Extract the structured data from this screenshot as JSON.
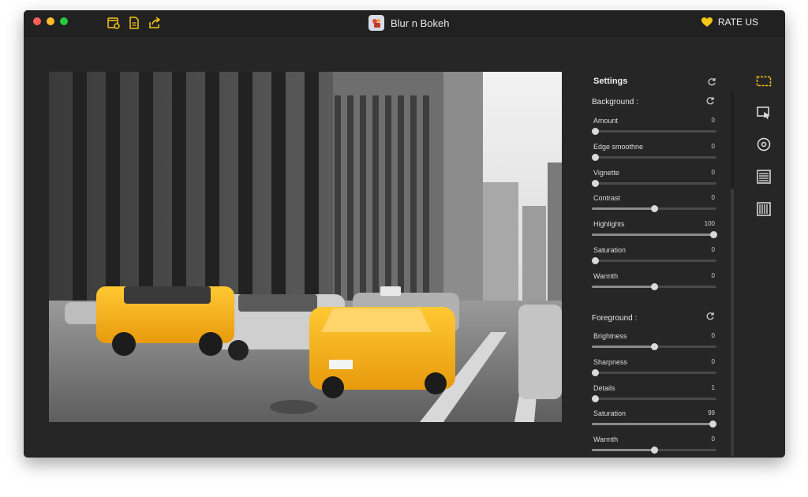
{
  "app": {
    "title": "Blur n Bokeh"
  },
  "header": {
    "rate_label": "RATE US"
  },
  "toolbar": {
    "icons": [
      "open-image-icon",
      "document-icon",
      "share-icon"
    ]
  },
  "colors": {
    "accent": "#f5c518",
    "background": "#262626",
    "titlebar": "#212121",
    "taxi": "#f7b21c"
  },
  "settings": {
    "title": "Settings",
    "background": {
      "title": "Background :",
      "sliders": [
        {
          "label": "Amount",
          "value": "0",
          "level": 0
        },
        {
          "label": "Edge smoothne",
          "value": "0",
          "level": 0
        },
        {
          "label": "Vignette",
          "value": "0",
          "level": 0
        },
        {
          "label": "Contrast",
          "value": "0",
          "level": 0.5
        },
        {
          "label": "Highlights",
          "value": "100",
          "level": 1
        },
        {
          "label": "Saturation",
          "value": "0",
          "level": 0
        },
        {
          "label": "Warmth",
          "value": "0",
          "level": 0.5
        }
      ]
    },
    "foreground": {
      "title": "Foreground :",
      "sliders": [
        {
          "label": "Brightness",
          "value": "0",
          "level": 0.5
        },
        {
          "label": "Sharpness",
          "value": "0",
          "level": 0
        },
        {
          "label": "Details",
          "value": "1",
          "level": 0
        },
        {
          "label": "Saturation",
          "value": "99",
          "level": 0.99
        },
        {
          "label": "Warmth",
          "value": "0",
          "level": 0.5
        }
      ]
    }
  },
  "tools": [
    "crop-frame-icon",
    "select-tool-icon",
    "focus-circle-icon",
    "lines-pattern-icon",
    "barcode-pattern-icon"
  ]
}
